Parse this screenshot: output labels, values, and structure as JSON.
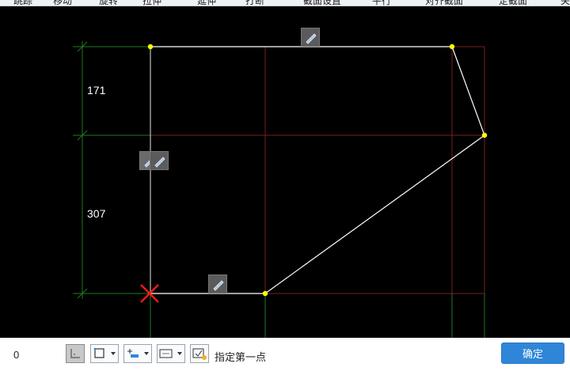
{
  "toolbar": {
    "items": [
      {
        "label": "跳踪",
        "icon": "pick-icon"
      },
      {
        "label": "移动",
        "icon": "move-icon"
      },
      {
        "label": "旋转",
        "icon": "rotate-icon"
      },
      {
        "label": "拉伸",
        "icon": "stretch-icon"
      },
      {
        "label": "延伸",
        "icon": "extend-icon"
      },
      {
        "label": "打断",
        "icon": "break-icon"
      },
      {
        "label": "截面设置",
        "icon": "section-icon"
      },
      {
        "label": "平行",
        "icon": "parallel-icon"
      },
      {
        "label": "对齐截面",
        "icon": "align-icon"
      },
      {
        "label": "定截面",
        "icon": "set-section-icon"
      },
      {
        "label": "关",
        "icon": "close-icon"
      }
    ]
  },
  "canvas": {
    "dimensions": [
      {
        "value": "171"
      },
      {
        "value": "307"
      }
    ],
    "colors": {
      "background": "#000000",
      "outline": "#ffffff",
      "vertex": "#ffff00",
      "grid_red": "#7a1f1f",
      "grid_green": "#1f7a1f",
      "origin_marker": "#ff1a1a"
    }
  },
  "statusbar": {
    "coordinate_value": "0",
    "prompt": "指定第一点",
    "confirm_label": "确定",
    "accent": "#2f86d8"
  }
}
